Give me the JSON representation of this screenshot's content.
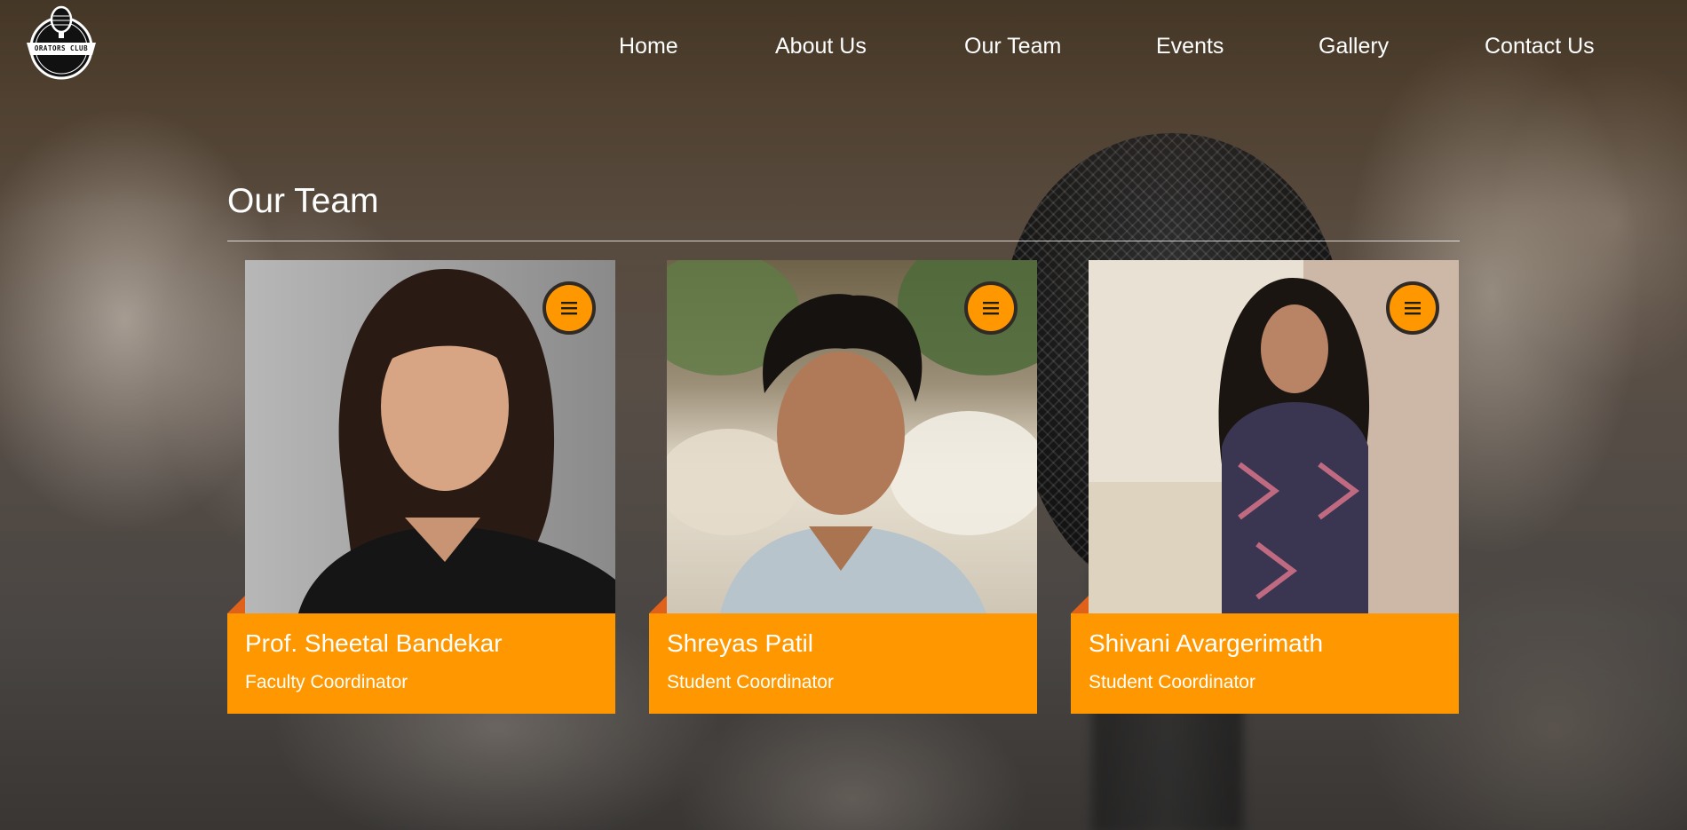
{
  "brand": {
    "logo_text": "ORATORS CLUB",
    "logo_icon": "microphone-icon"
  },
  "nav": {
    "items": [
      {
        "label": "Home"
      },
      {
        "label": "About Us"
      },
      {
        "label": "Our Team"
      },
      {
        "label": "Events"
      },
      {
        "label": "Gallery"
      },
      {
        "label": "Contact Us"
      }
    ]
  },
  "section": {
    "title": "Our Team"
  },
  "team": [
    {
      "name": "Prof. Sheetal Bandekar",
      "role": "Faculty Coordinator",
      "menu_icon": "hamburger-menu-icon"
    },
    {
      "name": "Shreyas Patil",
      "role": "Student Coordinator",
      "menu_icon": "hamburger-menu-icon"
    },
    {
      "name": "Shivani Avargerimath",
      "role": "Student Coordinator",
      "menu_icon": "hamburger-menu-icon"
    }
  ],
  "colors": {
    "accent": "#ff9800",
    "fold": "#e0621a",
    "button_border": "#2f2a26",
    "text": "#ffffff"
  }
}
